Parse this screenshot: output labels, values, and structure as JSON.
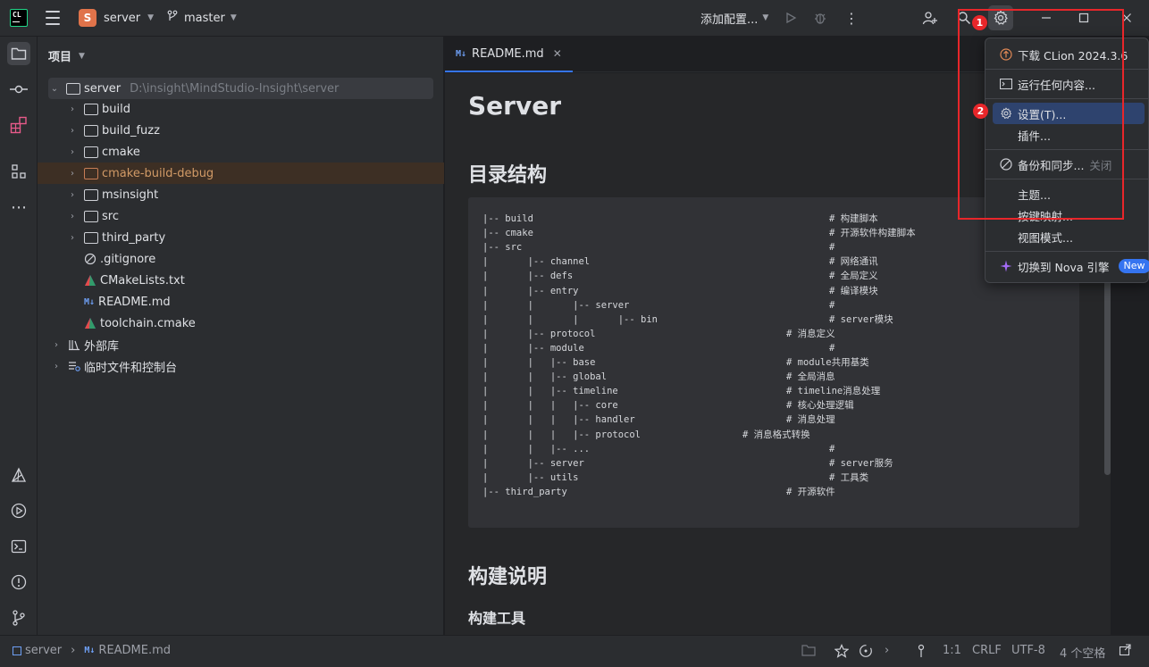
{
  "titlebar": {
    "logo_line1": "CL",
    "project_badge": "S",
    "project_name": "server",
    "branch": "master",
    "run_config": "添加配置...",
    "icons": [
      "menu-icon",
      "branch-icon",
      "run-icon",
      "debug-icon",
      "more-icon",
      "add-user-icon",
      "search-icon",
      "settings-icon"
    ]
  },
  "left_stripe": [
    "folder-icon",
    "commit-icon",
    "plugins-icon",
    "structure-icon",
    "more-icon",
    "cmake-icon",
    "run-icon",
    "terminal-icon",
    "problems-icon",
    "git-icon"
  ],
  "project_panel": {
    "title": "项目",
    "root": {
      "name": "server",
      "path": "D:\\insight\\MindStudio-Insight\\server"
    },
    "items": [
      {
        "name": "build",
        "kind": "folder"
      },
      {
        "name": "build_fuzz",
        "kind": "folder"
      },
      {
        "name": "cmake",
        "kind": "folder"
      },
      {
        "name": "cmake-build-debug",
        "kind": "folder-excluded"
      },
      {
        "name": "msinsight",
        "kind": "folder"
      },
      {
        "name": "src",
        "kind": "folder"
      },
      {
        "name": "third_party",
        "kind": "folder"
      },
      {
        "name": ".gitignore",
        "kind": "ignore"
      },
      {
        "name": "CMakeLists.txt",
        "kind": "cmake"
      },
      {
        "name": "README.md",
        "kind": "markdown"
      },
      {
        "name": "toolchain.cmake",
        "kind": "cmake"
      }
    ],
    "external_libs": "外部库",
    "scratches": "临时文件和控制台"
  },
  "editor": {
    "tab_icon": "M↓",
    "tab_label": "README.md",
    "h1": "Server",
    "h2_structure": "目录结构",
    "h2_build": "构建说明",
    "h3_tools": "构建工具",
    "code": [
      {
        "text": "|-- build",
        "comment": "# 构建脚本"
      },
      {
        "text": "|-- cmake",
        "comment": "# 开源软件构建脚本"
      },
      {
        "text": "|-- src",
        "comment": "#"
      },
      {
        "text": "|       |-- channel",
        "comment": "# 网络通讯"
      },
      {
        "text": "|       |-- defs",
        "comment": "# 全局定义"
      },
      {
        "text": "|       |-- entry",
        "comment": "# 编译模块"
      },
      {
        "text": "|       |       |-- server",
        "comment": "#"
      },
      {
        "text": "|       |       |       |-- bin",
        "comment": "# server模块"
      },
      {
        "text": "|       |-- protocol",
        "comment": "# 消息定义"
      },
      {
        "text": "|       |-- module",
        "comment": "#"
      },
      {
        "text": "|       |   |-- base",
        "comment": "# module共用基类"
      },
      {
        "text": "|       |   |-- global",
        "comment": "# 全局消息"
      },
      {
        "text": "|       |   |-- timeline",
        "comment": "# timeline消息处理"
      },
      {
        "text": "|       |   |   |-- core",
        "comment": "# 核心处理逻辑"
      },
      {
        "text": "|       |   |   |-- handler",
        "comment": "# 消息处理"
      },
      {
        "text": "|       |   |   |-- protocol",
        "comment": "# 消息格式转换"
      },
      {
        "text": "|       |   |-- ...",
        "comment": "#"
      },
      {
        "text": "|       |-- server",
        "comment": "# server服务"
      },
      {
        "text": "|       |-- utils",
        "comment": "# 工具类"
      },
      {
        "text": "|-- third_party",
        "comment": "# 开源软件"
      }
    ]
  },
  "popup_menu": {
    "download": "下载 CLion 2024.3.6",
    "run_anything": "运行任何内容...",
    "settings": "设置(T)...",
    "plugins": "插件...",
    "backup_sync": "备份和同步...",
    "backup_sync_state": "关闭",
    "theme": "主题...",
    "keymap": "按键映射...",
    "view_mode": "视图模式...",
    "switch_nova": "切换到 Nova 引擎",
    "new_badge": "New"
  },
  "annotations": {
    "step1": "1",
    "step2": "2",
    "frame_color": "#e8262a"
  },
  "statusbar": {
    "breadcrumb_root": "server",
    "breadcrumb_file": "README.md",
    "position": "1:1",
    "line_sep": "CRLF",
    "encoding": "UTF-8",
    "indent": "4 个空格"
  },
  "colors": {
    "accent": "#3574f0",
    "panel": "#2b2d30",
    "editor": "#1e1f22",
    "excluded": "#d19a66"
  }
}
